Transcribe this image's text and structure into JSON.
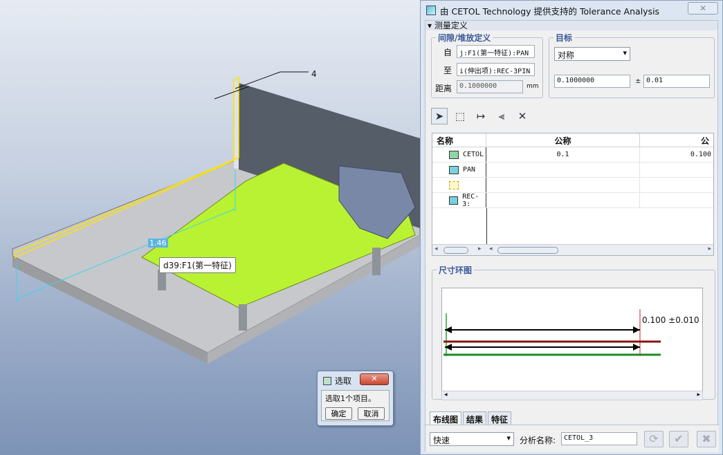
{
  "viewport": {
    "tooltip": "d39:F1(第一特征)",
    "dim_tag": "1.46",
    "dim_label": "4"
  },
  "dialog": {
    "title": "由 CETOL Technology 提供支持的 Tolerance Analysis",
    "section": "▾ 测量定义",
    "clearance": {
      "legend": "间隙/堆放定义",
      "from_label": "自",
      "from_value": "j:F1(第一特征):PAN",
      "to_label": "至",
      "to_value": "i(伸出项):REC-3PIN",
      "distance_label": "距离",
      "distance_value": "0.1000000",
      "unit": "mm"
    },
    "target": {
      "legend": "目标",
      "type": "对称",
      "nominal": "0.1000000",
      "pm": "±",
      "tol": "0.01"
    },
    "grid": {
      "headers": [
        "名称",
        "公称",
        "公"
      ],
      "rows": [
        {
          "name": "CETOL",
          "nominal": "0.1",
          "third": "0.100"
        },
        {
          "name": "PAN",
          "nominal": "",
          "third": ""
        },
        {
          "name": "",
          "nominal": "",
          "third": ""
        },
        {
          "name": "REC-3:",
          "nominal": "",
          "third": ""
        }
      ]
    },
    "loop": {
      "legend": "尺寸环图",
      "annotation": "0.100 ±0.010"
    },
    "tabs": [
      "布线图",
      "结果",
      "特征"
    ],
    "mode": "快速",
    "analysis_label": "分析名称:",
    "analysis_name": "CETOL_3"
  },
  "select_dialog": {
    "title": "选取",
    "message": "选取1个项目。",
    "ok": "确定",
    "cancel": "取消"
  }
}
